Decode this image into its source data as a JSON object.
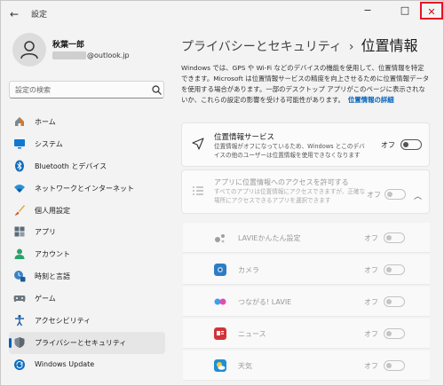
{
  "window": {
    "title": "設定",
    "back_icon": "←",
    "minimize_icon": "−",
    "maximize_icon": "□",
    "close_icon": "✕",
    "close_highlight_color": "#e81123"
  },
  "user": {
    "name": "秋葉一郎",
    "email_suffix": "@outlook.jp"
  },
  "search": {
    "placeholder": "設定の検索"
  },
  "nav": {
    "items": [
      {
        "label": "ホーム",
        "icon": "home-icon"
      },
      {
        "label": "システム",
        "icon": "system-icon"
      },
      {
        "label": "Bluetooth とデバイス",
        "icon": "bluetooth-icon"
      },
      {
        "label": "ネットワークとインターネット",
        "icon": "network-icon"
      },
      {
        "label": "個人用設定",
        "icon": "brush-icon"
      },
      {
        "label": "アプリ",
        "icon": "apps-icon"
      },
      {
        "label": "アカウント",
        "icon": "account-icon"
      },
      {
        "label": "時刻と言語",
        "icon": "time-language-icon"
      },
      {
        "label": "ゲーム",
        "icon": "game-icon"
      },
      {
        "label": "アクセシビリティ",
        "icon": "accessibility-icon"
      },
      {
        "label": "プライバシーとセキュリティ",
        "icon": "shield-icon",
        "selected": true
      },
      {
        "label": "Windows Update",
        "icon": "update-icon"
      }
    ],
    "accent_color": "#005fb8"
  },
  "main": {
    "breadcrumb_parent": "プライバシーとセキュリティ",
    "breadcrumb_sep": "›",
    "breadcrumb_current": "位置情報",
    "description": "Windows では、GPS や Wi-Fi などのデバイスの機能を使用して、位置情報を特定できます。Microsoft は位置情報サービスの精度を向上させるために位置情報データを使用する場合があります。一部のデスクトップ アプリがこのページに表示されないか、これらの設定の影響を受ける可能性があります。",
    "description_link": "位置情報の詳細",
    "location_service": {
      "title": "位置情報サービス",
      "subtitle": "位置情報がオフになっているため、Windows とこのデバイスの他のユーザーは位置情報を使用できなくなります",
      "toggle_label": "オフ",
      "on": false
    },
    "app_access": {
      "title": "アプリに位置情報へのアクセスを許可する",
      "subtitle": "すべてのアプリは位置情報にアクセスできますが、正確な場所にアクセスできるアプリを選択できます",
      "toggle_label": "オフ",
      "on": false
    },
    "apps": [
      {
        "name": "LAVIEかんたん設定",
        "toggle_label": "オフ",
        "icon": "gear-dots-icon",
        "color": "#9aa0a6"
      },
      {
        "name": "カメラ",
        "toggle_label": "オフ",
        "icon": "camera-icon",
        "color": "#2f7cc4"
      },
      {
        "name": "つながる! LAVIE",
        "toggle_label": "オフ",
        "icon": "link-icon",
        "color": "#c855c0"
      },
      {
        "name": "ニュース",
        "toggle_label": "オフ",
        "icon": "news-icon",
        "color": "#d13438"
      },
      {
        "name": "天気",
        "toggle_label": "オフ",
        "icon": "weather-icon",
        "color": "#1f8fd6"
      }
    ]
  }
}
